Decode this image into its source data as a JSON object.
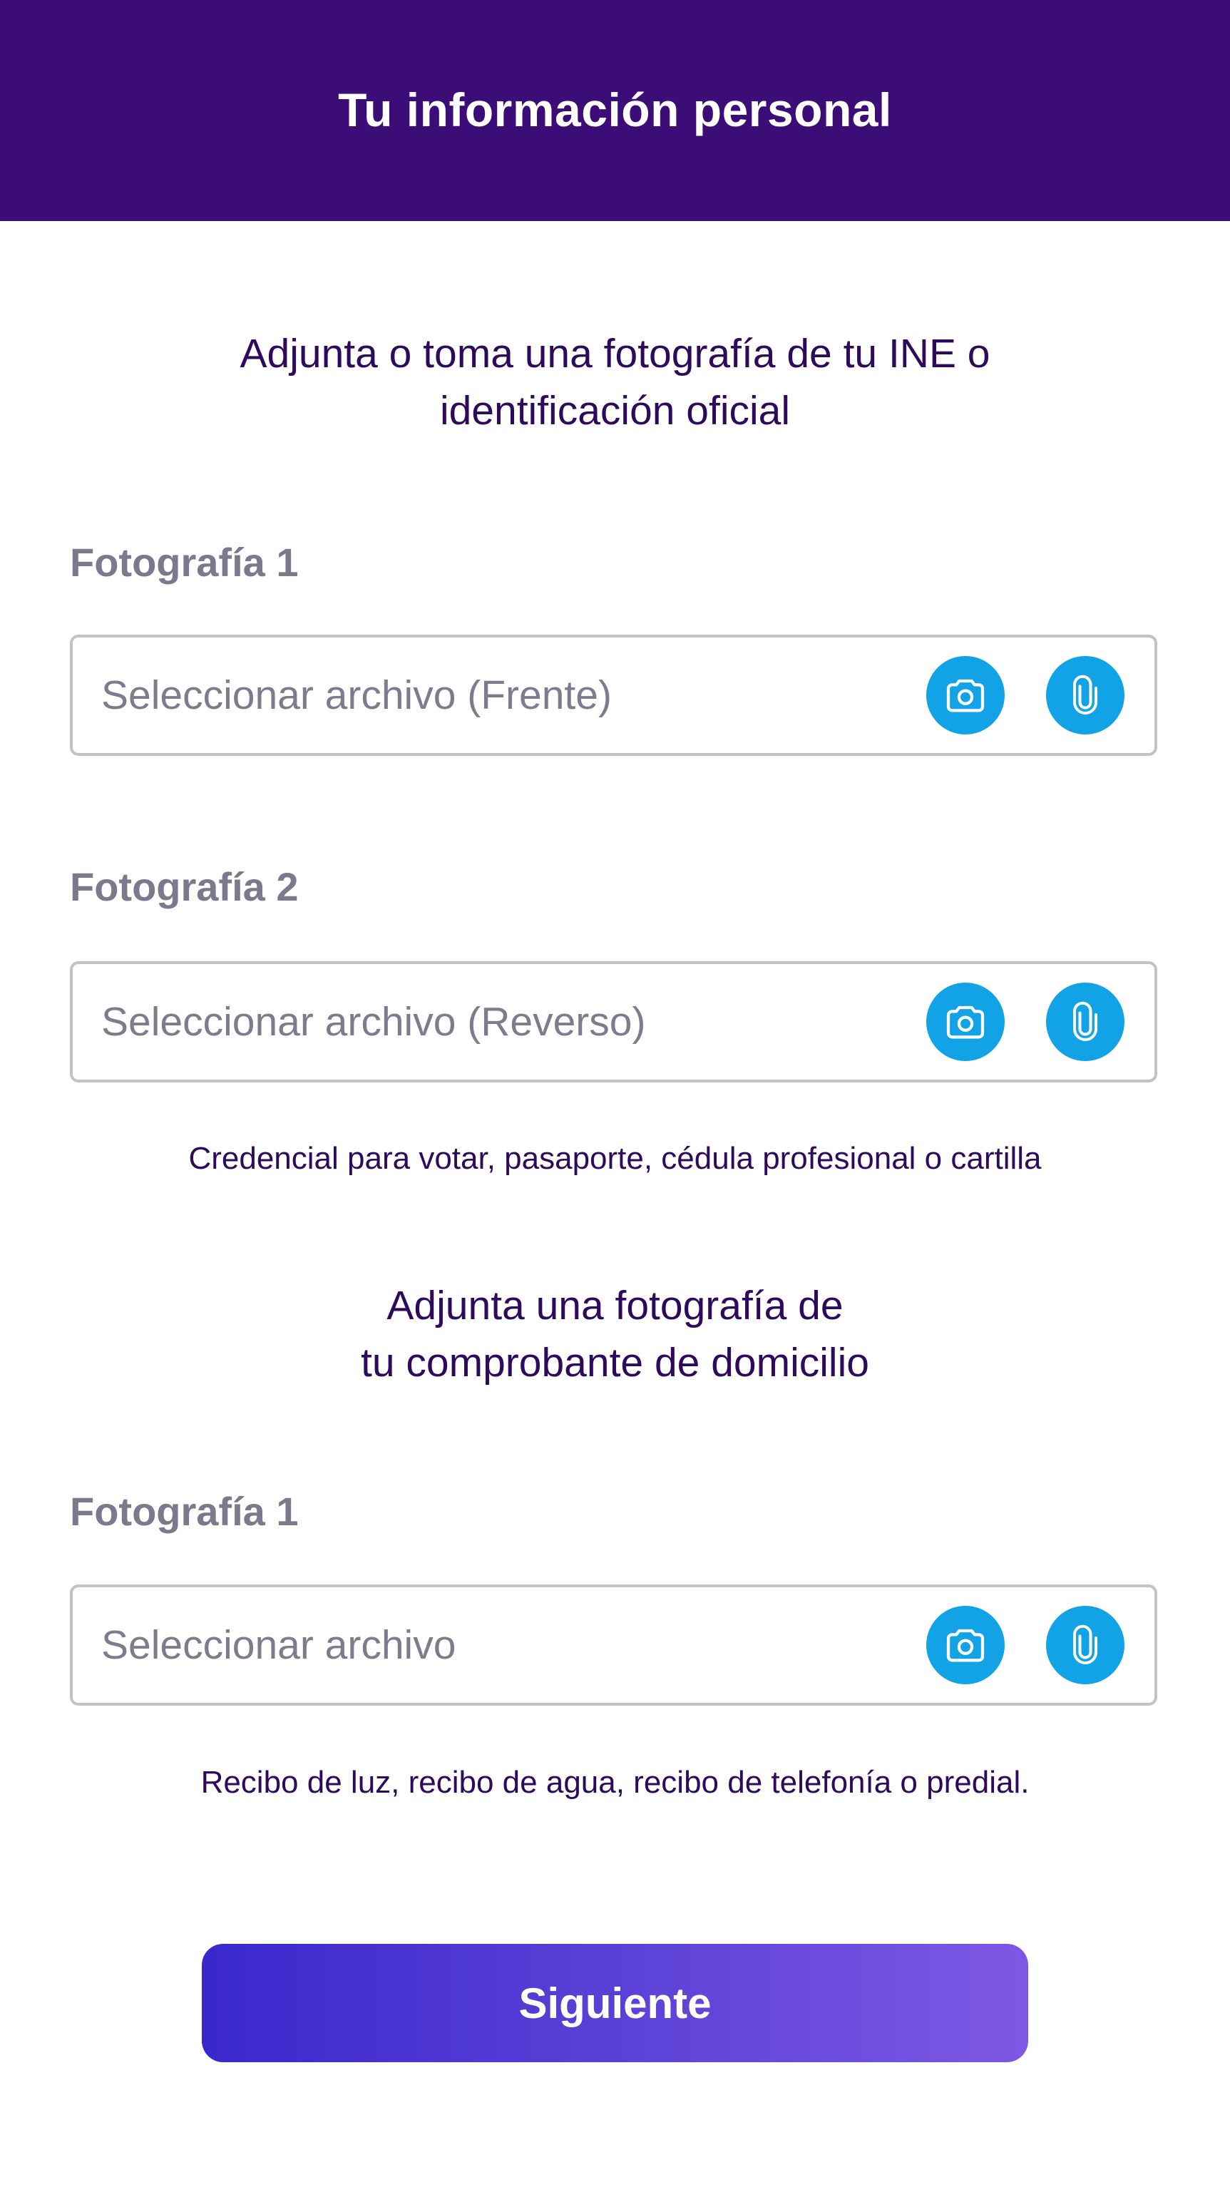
{
  "header": {
    "title": "Tu información personal"
  },
  "id_section": {
    "title_line1": "Adjunta o toma una fotografía de tu INE o",
    "title_line2": "identificación oficial",
    "fields": [
      {
        "label": "Fotografía 1",
        "placeholder": "Seleccionar archivo (Frente)",
        "camera_icon": "camera-icon",
        "attach_icon": "paperclip-icon"
      },
      {
        "label": "Fotografía 2",
        "placeholder": "Seleccionar archivo (Reverso)",
        "camera_icon": "camera-icon",
        "attach_icon": "paperclip-icon"
      }
    ],
    "helper": "Credencial para votar, pasaporte, cédula profesional o cartilla"
  },
  "address_section": {
    "title_line1": "Adjunta una fotografía de",
    "title_line2": "tu comprobante de domicilio",
    "fields": [
      {
        "label": "Fotografía 1",
        "placeholder": "Seleccionar archivo",
        "camera_icon": "camera-icon",
        "attach_icon": "paperclip-icon"
      }
    ],
    "helper": "Recibo de luz, recibo de agua, recibo de telefonía o predial."
  },
  "next_button": {
    "label": "Siguiente"
  },
  "colors": {
    "header_bg": "#3c0d77",
    "icon_button": "#11a3e6",
    "text_primary": "#2e0a5c",
    "label_gray": "#7a7a8c",
    "button_gradient_start": "#3a27cc",
    "button_gradient_end": "#7e58e4"
  }
}
